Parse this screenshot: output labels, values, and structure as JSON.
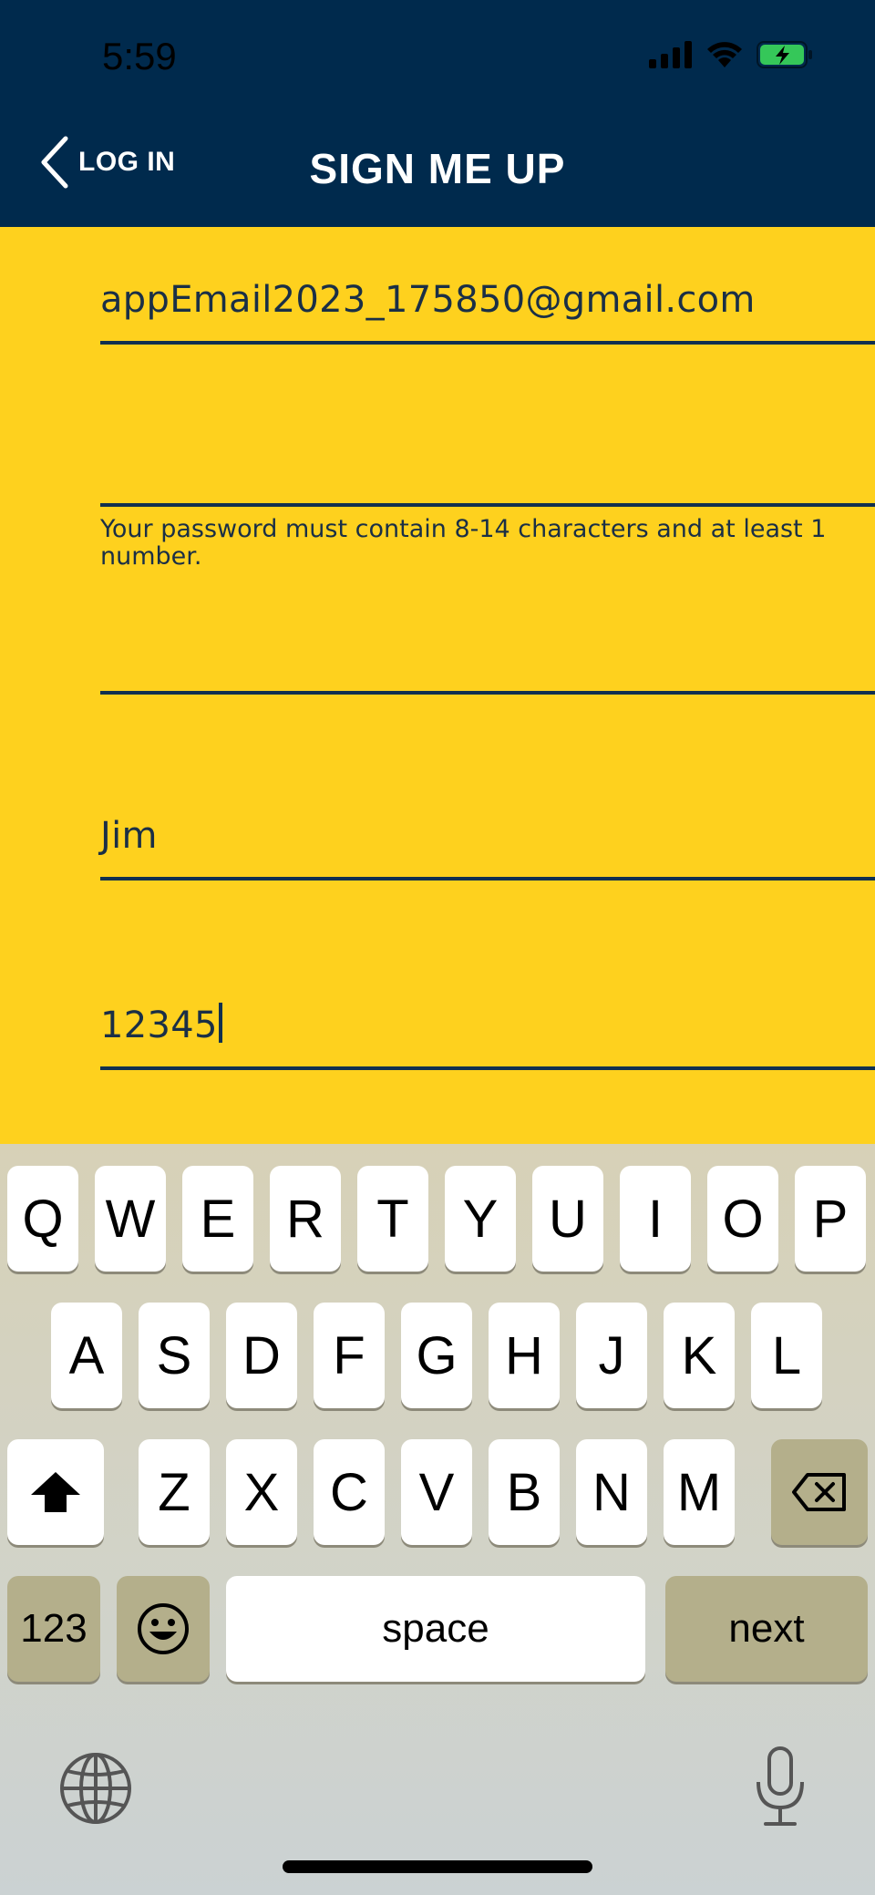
{
  "status_bar": {
    "time": "5:59"
  },
  "nav": {
    "back_label": "LOG IN",
    "title": "SIGN ME UP"
  },
  "form": {
    "email_value": "appEmail2023_175850@gmail.com",
    "password_value": "",
    "password_hint": "Your password must contain 8-14 characters and at least 1 number.",
    "confirm_password_value": "",
    "first_name_value": "Jim",
    "zip_value": "12345"
  },
  "keyboard": {
    "row1": [
      "Q",
      "W",
      "E",
      "R",
      "T",
      "Y",
      "U",
      "I",
      "O",
      "P"
    ],
    "row2": [
      "A",
      "S",
      "D",
      "F",
      "G",
      "H",
      "J",
      "K",
      "L"
    ],
    "row3": [
      "Z",
      "X",
      "C",
      "V",
      "B",
      "N",
      "M"
    ],
    "numbers_label": "123",
    "space_label": "space",
    "next_label": "next"
  },
  "colors": {
    "header": "#002a4d",
    "page": "#fed11e",
    "underline": "#11304f"
  }
}
